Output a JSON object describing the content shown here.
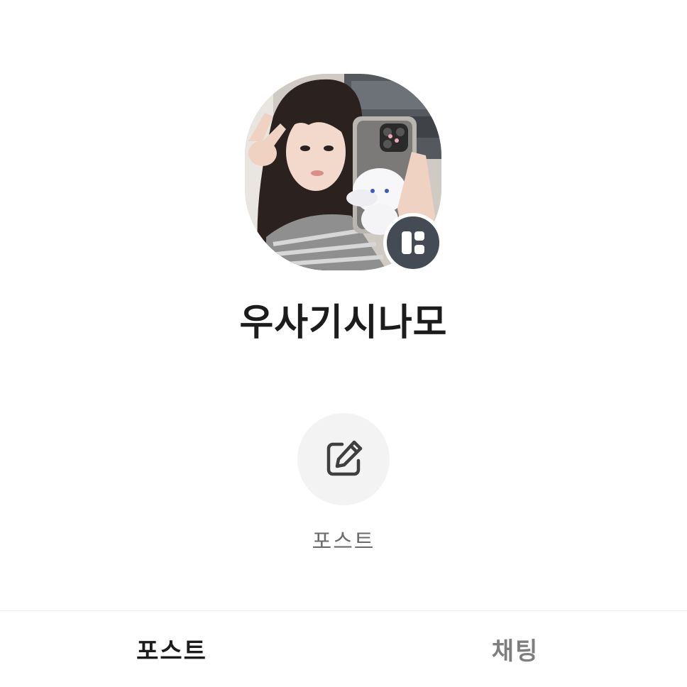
{
  "profile": {
    "name": "우사기시나모",
    "avatar_icon": "profile-photo",
    "badge_icon": "channel-icon"
  },
  "actions": {
    "post": {
      "icon": "edit-icon",
      "label": "포스트"
    }
  },
  "tabs": [
    {
      "label": "포스트",
      "active": true
    },
    {
      "label": "채팅",
      "active": false
    }
  ],
  "colors": {
    "background": "#ffffff",
    "text_primary": "#1c1c1c",
    "text_secondary": "#6b6b6b",
    "tab_inactive": "#7e7e7e",
    "badge": "#454b54",
    "action_circle": "#f3f3f3"
  }
}
